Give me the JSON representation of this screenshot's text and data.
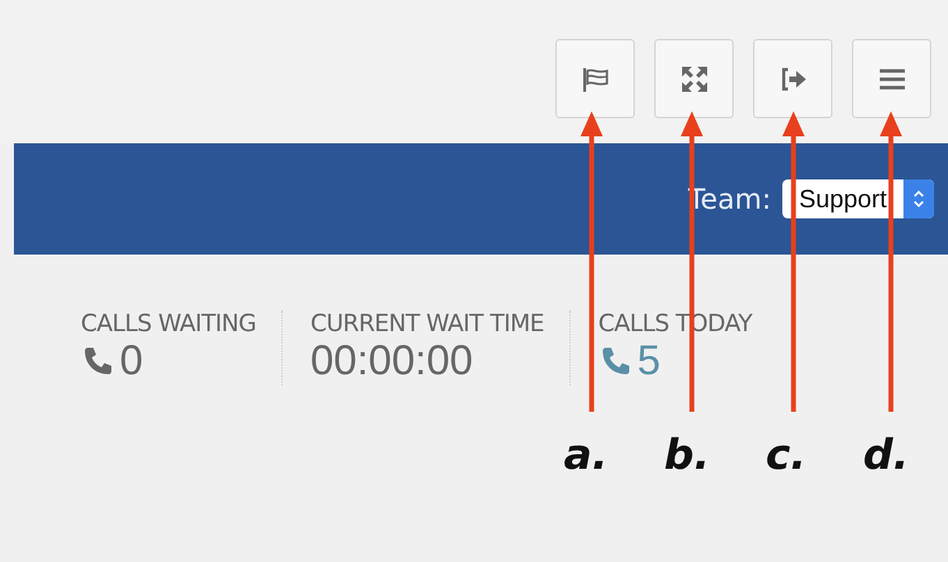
{
  "toolbar": {
    "buttons": [
      {
        "kind": "flag"
      },
      {
        "kind": "fullscreen"
      },
      {
        "kind": "signout"
      },
      {
        "kind": "menu"
      }
    ]
  },
  "team_bar": {
    "label": "Team:",
    "select": {
      "value": "Support"
    }
  },
  "stats": [
    {
      "label": "CALLS WAITING",
      "value": "0",
      "icon": true,
      "highlight": false
    },
    {
      "label": "CURRENT WAIT TIME",
      "value": "00:00:00",
      "icon": false,
      "highlight": false
    },
    {
      "label": "CALLS TODAY",
      "value": "5",
      "icon": true,
      "highlight": true
    }
  ],
  "annotations": [
    {
      "label": "a."
    },
    {
      "label": "b."
    },
    {
      "label": "c."
    },
    {
      "label": "d."
    }
  ]
}
